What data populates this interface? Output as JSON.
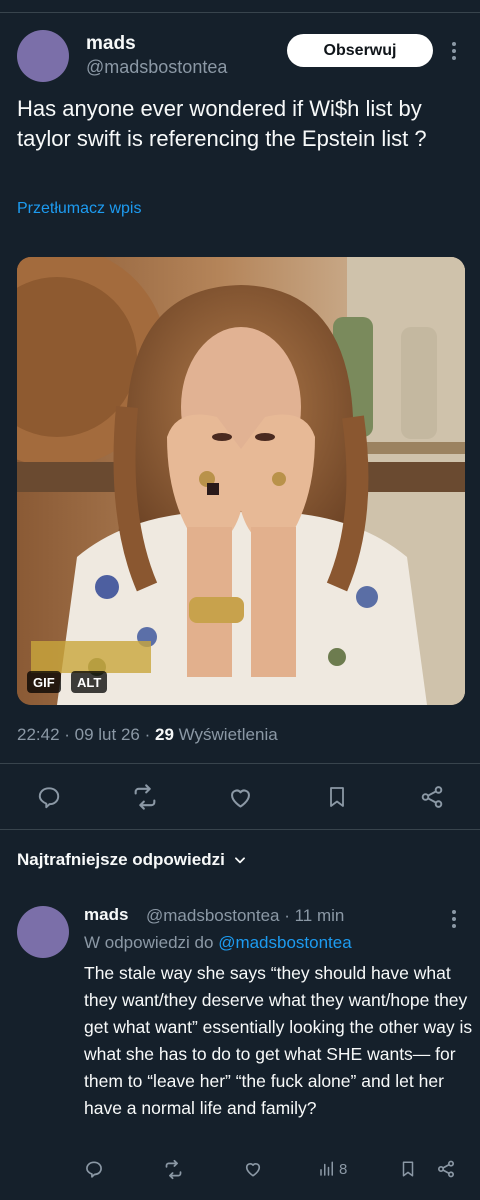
{
  "post": {
    "author_name": "mads",
    "author_handle": "@madsbostontea",
    "follow_label": "Obserwuj",
    "text": "Has anyone ever wondered if Wi$h list by taylor swift is referencing the Epstein list ?",
    "translate_label": "Przetłumacz wpis",
    "media": {
      "badges": [
        "GIF",
        "ALT"
      ]
    },
    "timestamp": "22:42 · 09 lut 26 · ",
    "views_count": "29",
    "views_label": " Wyświetlenia"
  },
  "actions": [
    "reply-icon",
    "retweet-icon",
    "like-icon",
    "bookmark-icon",
    "share-icon"
  ],
  "replies_sort_label": "Najtrafniejsze odpowiedzi",
  "reply": {
    "author_name": "mads",
    "author_handle_time": "@madsbostontea · 11 min",
    "reply_to_prefix": "W odpowiedzi do ",
    "reply_to_handle": "@madsbostontea",
    "text": "The stale way she says “they should have what they want/they deserve what they want/hope they get what want” essentially looking the other way is what she has to do to get what SHE wants— for them to “leave her” “the fuck alone” and let her have a normal life and family?",
    "views_count": "8"
  },
  "colors": {
    "background": "#15202b",
    "accent": "#1d9bf0",
    "secondary_text": "#8b98a5",
    "avatar": "#7b6fa9"
  }
}
